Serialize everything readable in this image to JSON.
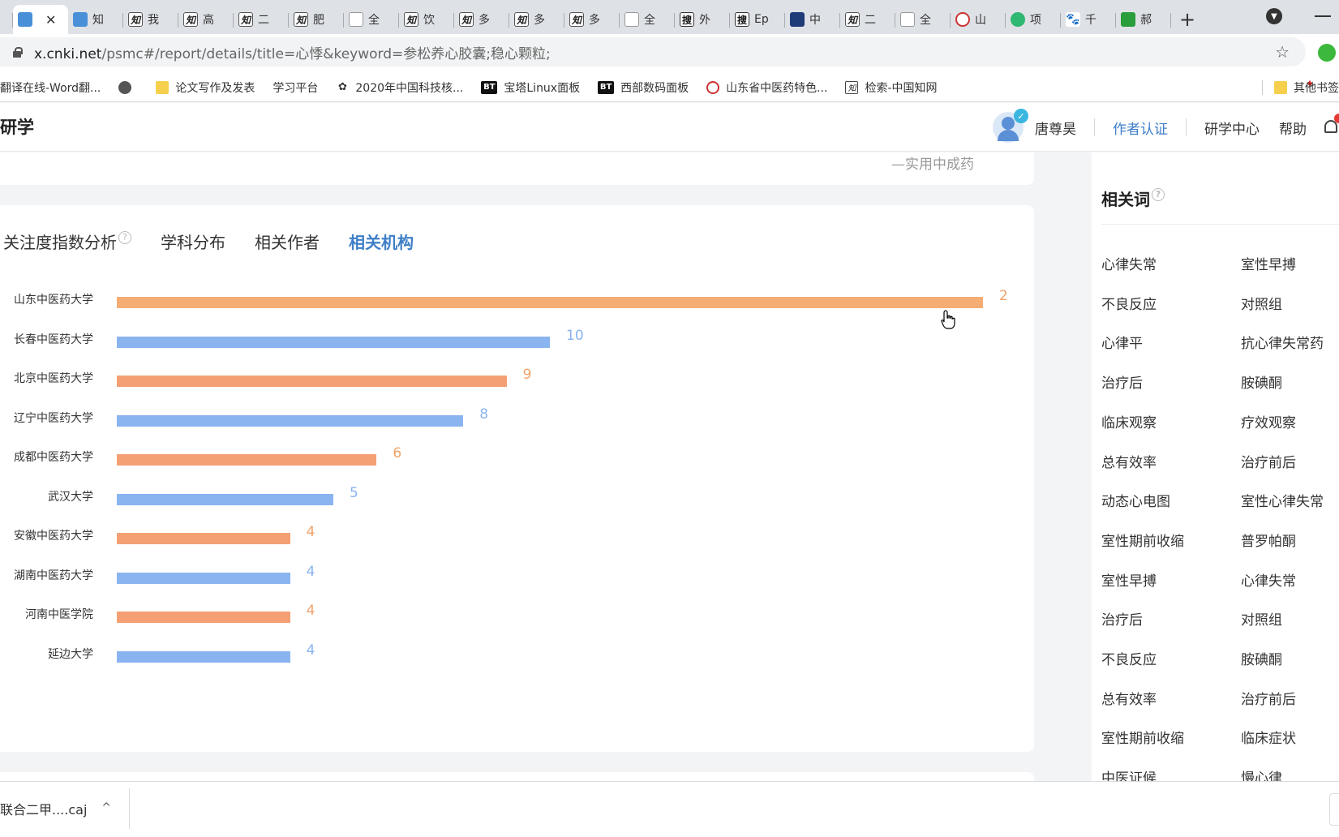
{
  "browser": {
    "tabs": [
      {
        "label": "",
        "icon": "partial-tab-icon",
        "kind": "partial"
      },
      {
        "label": "",
        "icon": "cnki-tab-icon",
        "kind": "active"
      },
      {
        "label": "知",
        "icon": "cnki-tab-icon",
        "kind": "blue"
      },
      {
        "label": "我",
        "icon": "zhi-icon",
        "kind": "zhi"
      },
      {
        "label": "高",
        "icon": "zhi-icon",
        "kind": "zhi"
      },
      {
        "label": "二",
        "icon": "zhi-icon",
        "kind": "zhi"
      },
      {
        "label": "肥",
        "icon": "zhi-icon",
        "kind": "zhi"
      },
      {
        "label": "全",
        "icon": "document-icon",
        "kind": "doc"
      },
      {
        "label": "饮",
        "icon": "zhi-icon",
        "kind": "zhi"
      },
      {
        "label": "多",
        "icon": "zhi-icon",
        "kind": "zhi"
      },
      {
        "label": "多",
        "icon": "zhi-icon",
        "kind": "zhi"
      },
      {
        "label": "多",
        "icon": "zhi-icon",
        "kind": "zhi"
      },
      {
        "label": "全",
        "icon": "document-icon",
        "kind": "doc"
      },
      {
        "label": "外",
        "icon": "sou-icon",
        "kind": "sou"
      },
      {
        "label": "Ep",
        "icon": "sou-icon",
        "kind": "sou"
      },
      {
        "label": "中",
        "icon": "dark-logo-icon",
        "kind": "dark"
      },
      {
        "label": "二",
        "icon": "zhi-icon",
        "kind": "zhi"
      },
      {
        "label": "全",
        "icon": "document-icon",
        "kind": "doc"
      },
      {
        "label": "山",
        "icon": "red-ring-icon",
        "kind": "red"
      },
      {
        "label": "项",
        "icon": "green-bolt-icon",
        "kind": "green"
      },
      {
        "label": "千",
        "icon": "paw-icon",
        "kind": "paw"
      },
      {
        "label": "郝",
        "icon": "green-square-icon",
        "kind": "greensq"
      }
    ],
    "tab_close_symbol": "✕",
    "new_tab_symbol": "+",
    "url_host": "x.cnki.net",
    "url_path": "/psmc#/report/details/title=心悸&keyword=参松养心胶囊;稳心颗粒;",
    "bookmarks": [
      {
        "label": "翻译在线-Word翻...",
        "icon": "translate-icon",
        "kind": "none"
      },
      {
        "label": "",
        "icon": "globe-icon",
        "kind": "globe"
      },
      {
        "label": "论文写作及发表",
        "icon": "folder-icon",
        "kind": "folder"
      },
      {
        "label": "学习平台",
        "icon": "star-logo-icon",
        "kind": "star"
      },
      {
        "label": "2020年中国科技核...",
        "icon": "tree-icon",
        "kind": "tree"
      },
      {
        "label": "宝塔Linux面板",
        "icon": "bt-icon",
        "kind": "bt"
      },
      {
        "label": "西部数码面板",
        "icon": "bt-icon",
        "kind": "bt"
      },
      {
        "label": "山东省中医药特色...",
        "icon": "red-ring-icon",
        "kind": "ring"
      },
      {
        "label": "检索-中国知网",
        "icon": "zhi-icon",
        "kind": "zhi"
      }
    ],
    "other_bookmarks": "其他书签"
  },
  "header": {
    "brand": "研学",
    "user_name": "唐尊昊",
    "author_auth": "作者认证",
    "research_center": "研学中心",
    "help": "帮助"
  },
  "top_card": {
    "text": "—实用中成药"
  },
  "analysis": {
    "tabs": [
      {
        "label": "关注度指数分析",
        "active": false,
        "help": true
      },
      {
        "label": "学科分布",
        "active": false,
        "help": false
      },
      {
        "label": "相关作者",
        "active": false,
        "help": false
      },
      {
        "label": "相关机构",
        "active": true,
        "help": false
      }
    ],
    "help_symbol": "?"
  },
  "chart_data": {
    "type": "bar",
    "orientation": "horizontal",
    "categories": [
      "山东中医药大学",
      "长春中医药大学",
      "北京中医药大学",
      "辽宁中医药大学",
      "成都中医药大学",
      "武汉大学",
      "安徽中医药大学",
      "湖南中医药大学",
      "河南中医学院",
      "延边大学"
    ],
    "values": [
      20,
      10,
      9,
      8,
      6,
      5,
      4,
      4,
      4,
      4
    ],
    "value_labels": [
      "2",
      "10",
      "9",
      "8",
      "6",
      "5",
      "4",
      "4",
      "4",
      "4"
    ],
    "colors": [
      "#f5ad74",
      "#8ab4f0",
      "#f5a074",
      "#8ab4f0",
      "#f5a074",
      "#8ab4f0",
      "#f5a074",
      "#8ab4f0",
      "#f5a074",
      "#8ab4f0"
    ],
    "label_colors": [
      "#f0a36a",
      "#8ab4f0",
      "#f0a36a",
      "#8ab4f0",
      "#f0a36a",
      "#8ab4f0",
      "#f0a36a",
      "#8ab4f0",
      "#f0a36a",
      "#8ab4f0"
    ],
    "xlim": [
      0,
      20
    ],
    "grid": false,
    "legend": "none",
    "title": ""
  },
  "related_words": {
    "title": "相关词",
    "left": [
      "心律失常",
      "不良反应",
      "心律平",
      "治疗后",
      "临床观察",
      "总有效率",
      "动态心电图",
      "室性期前收缩",
      "室性早搏",
      "治疗后",
      "不良反应",
      "总有效率",
      "室性期前收缩",
      "中医证候"
    ],
    "right": [
      "室性早搏",
      "对照组",
      "抗心律失常药",
      "胺碘酮",
      "疗效观察",
      "治疗前后",
      "室性心律失常",
      "普罗帕酮",
      "心律失常",
      "对照组",
      "胺碘酮",
      "治疗前后",
      "临床症状",
      "慢心律"
    ]
  },
  "downloads": {
    "file_name": "联合二甲....caj",
    "arrow": "^"
  },
  "colors": {
    "accent": "#3f7fc8",
    "orange_bar": "#f5a074",
    "blue_bar": "#8ab4f0"
  }
}
